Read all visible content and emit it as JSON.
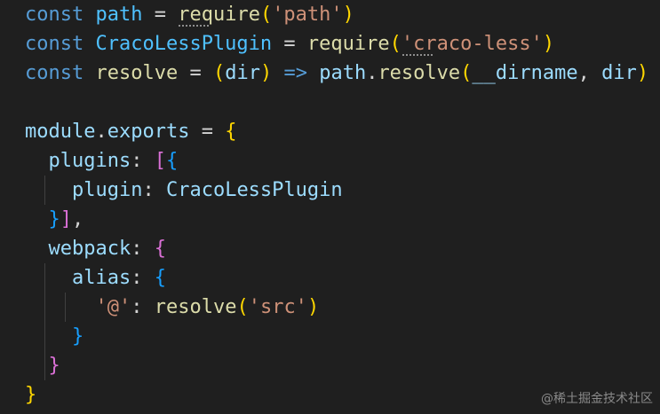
{
  "code": {
    "lines": [
      [
        {
          "t": "const",
          "c": "kw"
        },
        {
          "t": " ",
          "c": "id"
        },
        {
          "t": "path",
          "c": "var"
        },
        {
          "t": " = ",
          "c": "op"
        },
        {
          "t": "require",
          "c": "fn"
        },
        {
          "t": "(",
          "c": "b1"
        },
        {
          "t": "'path'",
          "c": "str"
        },
        {
          "t": ")",
          "c": "b1"
        }
      ],
      [
        {
          "t": "const",
          "c": "kw"
        },
        {
          "t": " ",
          "c": "id"
        },
        {
          "t": "CracoLessPlugin",
          "c": "var"
        },
        {
          "t": " = ",
          "c": "op"
        },
        {
          "t": "require",
          "c": "fn"
        },
        {
          "t": "(",
          "c": "b1"
        },
        {
          "t": "'craco-less'",
          "c": "str"
        },
        {
          "t": ")",
          "c": "b1"
        }
      ],
      [
        {
          "t": "const",
          "c": "kw"
        },
        {
          "t": " ",
          "c": "id"
        },
        {
          "t": "resolve",
          "c": "fn"
        },
        {
          "t": " = ",
          "c": "op"
        },
        {
          "t": "(",
          "c": "b1"
        },
        {
          "t": "dir",
          "c": "prop"
        },
        {
          "t": ")",
          "c": "b1"
        },
        {
          "t": " ",
          "c": "id"
        },
        {
          "t": "=>",
          "c": "kw"
        },
        {
          "t": " ",
          "c": "id"
        },
        {
          "t": "path",
          "c": "prop"
        },
        {
          "t": ".",
          "c": "op"
        },
        {
          "t": "resolve",
          "c": "fn"
        },
        {
          "t": "(",
          "c": "b1"
        },
        {
          "t": "__dirname",
          "c": "prop"
        },
        {
          "t": ", ",
          "c": "op"
        },
        {
          "t": "dir",
          "c": "prop"
        },
        {
          "t": ")",
          "c": "b1"
        }
      ],
      [],
      [
        {
          "t": "module",
          "c": "prop"
        },
        {
          "t": ".",
          "c": "op"
        },
        {
          "t": "exports",
          "c": "prop"
        },
        {
          "t": " = ",
          "c": "op"
        },
        {
          "t": "{",
          "c": "b1"
        }
      ],
      [
        {
          "t": "  ",
          "c": "id"
        },
        {
          "t": "plugins",
          "c": "prop"
        },
        {
          "t": ": ",
          "c": "op"
        },
        {
          "t": "[",
          "c": "b2"
        },
        {
          "t": "{",
          "c": "b3"
        }
      ],
      [
        {
          "t": "    ",
          "c": "id"
        },
        {
          "t": "plugin",
          "c": "prop"
        },
        {
          "t": ": ",
          "c": "op"
        },
        {
          "t": "CracoLessPlugin",
          "c": "prop"
        }
      ],
      [
        {
          "t": "  ",
          "c": "id"
        },
        {
          "t": "}",
          "c": "b3"
        },
        {
          "t": "]",
          "c": "b2"
        },
        {
          "t": ",",
          "c": "op"
        }
      ],
      [
        {
          "t": "  ",
          "c": "id"
        },
        {
          "t": "webpack",
          "c": "prop"
        },
        {
          "t": ": ",
          "c": "op"
        },
        {
          "t": "{",
          "c": "b2"
        }
      ],
      [
        {
          "t": "    ",
          "c": "id"
        },
        {
          "t": "alias",
          "c": "prop"
        },
        {
          "t": ": ",
          "c": "op"
        },
        {
          "t": "{",
          "c": "b3"
        }
      ],
      [
        {
          "t": "      ",
          "c": "id"
        },
        {
          "t": "'@'",
          "c": "str"
        },
        {
          "t": ": ",
          "c": "op"
        },
        {
          "t": "resolve",
          "c": "fn"
        },
        {
          "t": "(",
          "c": "b1"
        },
        {
          "t": "'src'",
          "c": "str"
        },
        {
          "t": ")",
          "c": "b1"
        }
      ],
      [
        {
          "t": "    ",
          "c": "id"
        },
        {
          "t": "}",
          "c": "b3"
        }
      ],
      [
        {
          "t": "  ",
          "c": "id"
        },
        {
          "t": "}",
          "c": "b2"
        }
      ],
      [
        {
          "t": "}",
          "c": "b1"
        }
      ]
    ]
  },
  "colors": {
    "background": "#1f1f1f",
    "keyword": "#569cd6",
    "variable": "#4fc1ff",
    "function": "#dcdcaa",
    "property": "#9cdcfe",
    "string": "#ce9178",
    "bracket_level_1": "#ffd700",
    "bracket_level_2": "#da70d6",
    "bracket_level_3": "#179fff"
  },
  "watermark": {
    "text": "@稀土掘金技术社区"
  }
}
